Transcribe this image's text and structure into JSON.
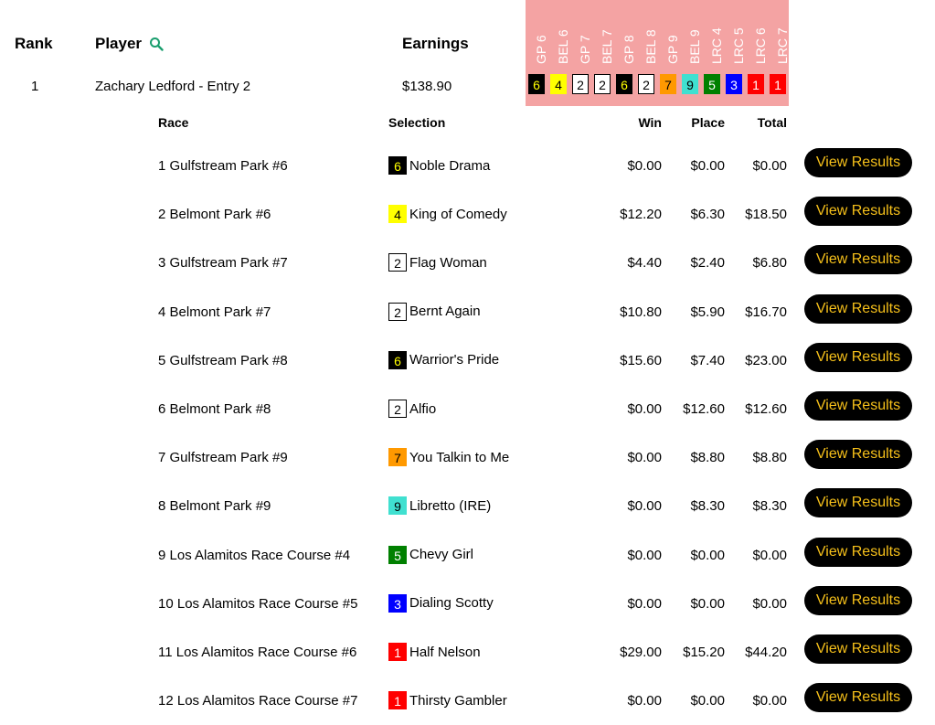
{
  "headers": {
    "rank": "Rank",
    "player": "Player",
    "earnings": "Earnings"
  },
  "race_columns": [
    "GP 6",
    "BEL 6",
    "GP 7",
    "BEL 7",
    "GP 8",
    "BEL 8",
    "GP 9",
    "BEL 9",
    "LRC 4",
    "LRC 5",
    "LRC 6",
    "LRC 7"
  ],
  "entry": {
    "rank": "1",
    "player": "Zachary Ledford - Entry 2",
    "earnings": "$138.90",
    "picks": [
      {
        "num": "6",
        "bg": "#000000",
        "fg": "#ffff00",
        "border": "#000000"
      },
      {
        "num": "4",
        "bg": "#ffff00",
        "fg": "#000000",
        "border": "#ffff00"
      },
      {
        "num": "2",
        "bg": "#ffffff",
        "fg": "#000000",
        "border": "#000000"
      },
      {
        "num": "2",
        "bg": "#ffffff",
        "fg": "#000000",
        "border": "#000000"
      },
      {
        "num": "6",
        "bg": "#000000",
        "fg": "#ffff00",
        "border": "#000000"
      },
      {
        "num": "2",
        "bg": "#ffffff",
        "fg": "#000000",
        "border": "#000000"
      },
      {
        "num": "7",
        "bg": "#ff9900",
        "fg": "#000000",
        "border": "#ff9900"
      },
      {
        "num": "9",
        "bg": "#40e0d0",
        "fg": "#000000",
        "border": "#40e0d0"
      },
      {
        "num": "5",
        "bg": "#008000",
        "fg": "#ffffff",
        "border": "#008000"
      },
      {
        "num": "3",
        "bg": "#0000ff",
        "fg": "#ffffff",
        "border": "#0000ff"
      },
      {
        "num": "1",
        "bg": "#ff0000",
        "fg": "#ffffff",
        "border": "#ff0000"
      },
      {
        "num": "1",
        "bg": "#ff0000",
        "fg": "#ffffff",
        "border": "#ff0000"
      }
    ]
  },
  "detail_headers": {
    "race": "Race",
    "selection": "Selection",
    "win": "Win",
    "place": "Place",
    "total": "Total"
  },
  "button_label": "View Results",
  "rows": [
    {
      "race": "1 Gulfstream Park #6",
      "num": "6",
      "bg": "#000000",
      "fg": "#ffff00",
      "border": "#000000",
      "horse": "Noble Drama",
      "win": "$0.00",
      "place": "$0.00",
      "total": "$0.00"
    },
    {
      "race": "2 Belmont Park #6",
      "num": "4",
      "bg": "#ffff00",
      "fg": "#000000",
      "border": "#ffff00",
      "horse": "King of Comedy",
      "win": "$12.20",
      "place": "$6.30",
      "total": "$18.50"
    },
    {
      "race": "3 Gulfstream Park #7",
      "num": "2",
      "bg": "#ffffff",
      "fg": "#000000",
      "border": "#000000",
      "horse": "Flag Woman",
      "win": "$4.40",
      "place": "$2.40",
      "total": "$6.80"
    },
    {
      "race": "4 Belmont Park #7",
      "num": "2",
      "bg": "#ffffff",
      "fg": "#000000",
      "border": "#000000",
      "horse": "Bernt Again",
      "win": "$10.80",
      "place": "$5.90",
      "total": "$16.70"
    },
    {
      "race": "5 Gulfstream Park #8",
      "num": "6",
      "bg": "#000000",
      "fg": "#ffff00",
      "border": "#000000",
      "horse": "Warrior's Pride",
      "win": "$15.60",
      "place": "$7.40",
      "total": "$23.00"
    },
    {
      "race": "6 Belmont Park #8",
      "num": "2",
      "bg": "#ffffff",
      "fg": "#000000",
      "border": "#000000",
      "horse": "Alfio",
      "win": "$0.00",
      "place": "$12.60",
      "total": "$12.60"
    },
    {
      "race": "7 Gulfstream Park #9",
      "num": "7",
      "bg": "#ff9900",
      "fg": "#000000",
      "border": "#ff9900",
      "horse": "You Talkin to Me",
      "win": "$0.00",
      "place": "$8.80",
      "total": "$8.80"
    },
    {
      "race": "8 Belmont Park #9",
      "num": "9",
      "bg": "#40e0d0",
      "fg": "#000000",
      "border": "#40e0d0",
      "horse": "Libretto (IRE)",
      "win": "$0.00",
      "place": "$8.30",
      "total": "$8.30"
    },
    {
      "race": "9 Los Alamitos Race Course #4",
      "num": "5",
      "bg": "#008000",
      "fg": "#ffffff",
      "border": "#008000",
      "horse": "Chevy Girl",
      "win": "$0.00",
      "place": "$0.00",
      "total": "$0.00"
    },
    {
      "race": "10 Los Alamitos Race Course #5",
      "num": "3",
      "bg": "#0000ff",
      "fg": "#ffffff",
      "border": "#0000ff",
      "horse": "Dialing Scotty",
      "win": "$0.00",
      "place": "$0.00",
      "total": "$0.00"
    },
    {
      "race": "11 Los Alamitos Race Course #6",
      "num": "1",
      "bg": "#ff0000",
      "fg": "#ffffff",
      "border": "#ff0000",
      "horse": "Half Nelson",
      "win": "$29.00",
      "place": "$15.20",
      "total": "$44.20"
    },
    {
      "race": "12 Los Alamitos Race Course #7",
      "num": "1",
      "bg": "#ff0000",
      "fg": "#ffffff",
      "border": "#ff0000",
      "horse": "Thirsty Gambler",
      "win": "$0.00",
      "place": "$0.00",
      "total": "$0.00"
    }
  ]
}
